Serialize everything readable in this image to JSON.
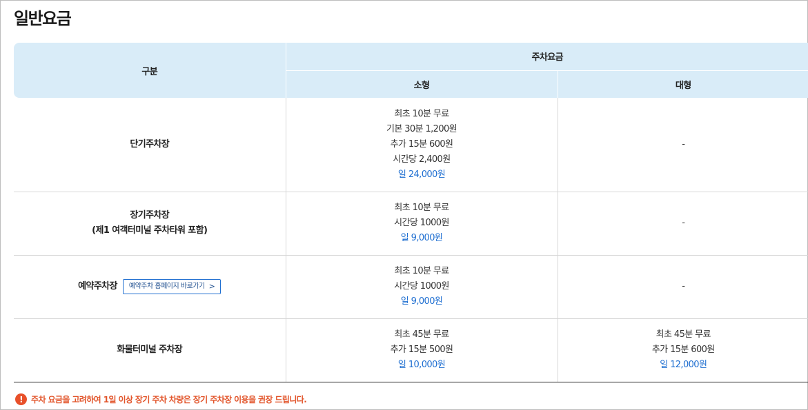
{
  "page": {
    "title": "일반요금"
  },
  "table": {
    "headers": {
      "category": "구분",
      "fee": "주차요금",
      "small": "소형",
      "large": "대형"
    },
    "rows": [
      {
        "category": "단기주차장",
        "small": [
          "최초 10분 무료",
          "기본 30분 1,200원",
          "추가 15분 600원",
          "시간당 2,400원",
          "일 24,000원"
        ],
        "large": "-"
      },
      {
        "category": "장기주차장",
        "category_sub": "(제1 여객터미널 주차타워 포함)",
        "small": [
          "최초 10분 무료",
          "시간당 1000원",
          "일 9,000원"
        ],
        "large": "-"
      },
      {
        "category": "예약주차장",
        "link_label": "예약주차 홈페이지 바로가기",
        "link_icon": "chevron-right-icon",
        "small": [
          "최초 10분 무료",
          "시간당 1000원",
          "일 9,000원"
        ],
        "large": "-"
      },
      {
        "category": "화물터미널 주차장",
        "small": [
          "최초 45분 무료",
          "추가 15분 500원",
          "일 10,000원"
        ],
        "large": [
          "최초 45분 무료",
          "추가 15분 600원",
          "일 12,000원"
        ]
      }
    ]
  },
  "notice": {
    "icon": "alert-icon",
    "icon_glyph": "!",
    "text": "주차 요금을 고려하여 1일 이상 장기 주차 차량은 장기 주차장 이용을 권장 드립니다.",
    "color": "#e2552b"
  },
  "colors": {
    "header_bg": "#d9ecf8",
    "accent_blue": "#1f6fd1"
  }
}
